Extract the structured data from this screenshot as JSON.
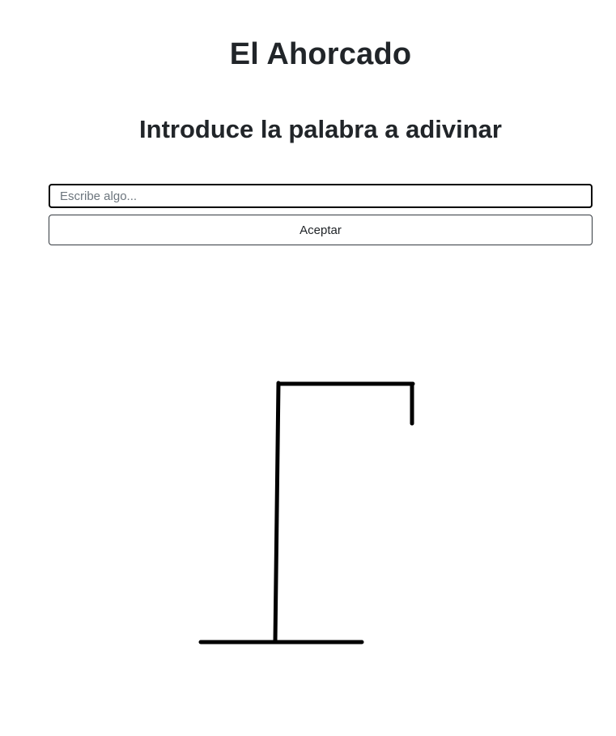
{
  "header": {
    "title": "El Ahorcado",
    "subtitle": "Introduce la palabra a adivinar"
  },
  "form": {
    "input_placeholder": "Escribe algo...",
    "input_value": "",
    "accept_label": "Aceptar"
  },
  "drawing": {
    "stroke_color": "#000000",
    "stage": "gallows"
  }
}
